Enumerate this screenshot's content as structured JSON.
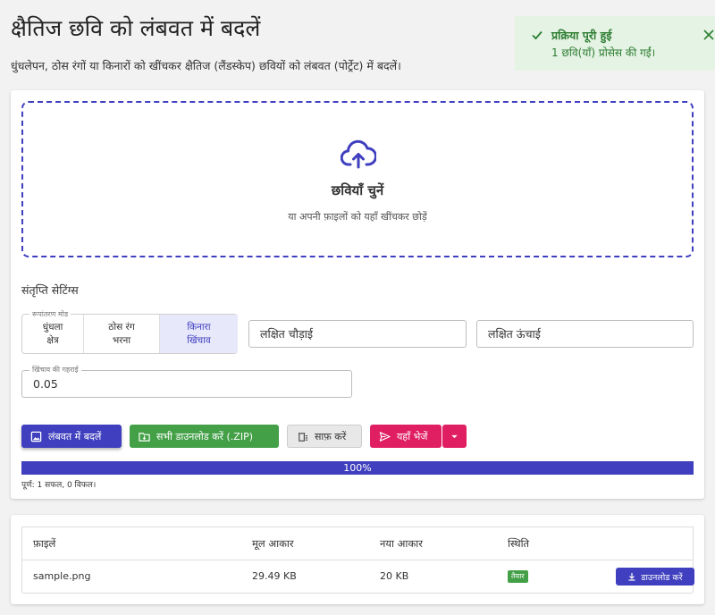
{
  "page": {
    "title": "क्षैतिज छवि को लंबवत में बदलें",
    "subtitle": "धुंधलेपन, ठोस रंगों या किनारों को खींचकर क्षैतिज (लैंडस्केप) छवियों को लंबवत (पोर्ट्रेट) में बदलें।"
  },
  "toast": {
    "title": "प्रक्रिया पूरी हुई",
    "message": "1 छवि(याँ) प्रोसेस की गईं।",
    "icon": "check-icon",
    "close_icon": "close-icon",
    "color": "#2e7d32"
  },
  "dropzone": {
    "title": "छवियाँ चुनें",
    "subtitle": "या अपनी फ़ाइलों को यहाँ खींचकर छोड़ें",
    "icon": "cloud-upload-icon"
  },
  "settings": {
    "section_title": "संतृप्ति सेटिंग्स",
    "mode_legend": "रूपांतरण मोड",
    "modes": [
      {
        "line1": "धुंधला",
        "line2": "क्षेत्र"
      },
      {
        "line1": "ठोस रंग",
        "line2": "भरना"
      },
      {
        "line1": "किनारा",
        "line2": "खिंचाव"
      }
    ],
    "selected_mode": "किनारा खिंचाव",
    "target_width_placeholder": "लक्षित चौड़ाई",
    "target_height_placeholder": "लक्षित ऊंचाई",
    "depth_legend": "खिंचाव की गहराई",
    "depth_value": "0.05"
  },
  "actions": {
    "convert": "लंबवत में बदलें",
    "download_all": "सभी डाउनलोड करें (.ZIP)",
    "clear": "साफ़ करें",
    "send": "यहाँ भेजें",
    "primary_color": "#3f3fbf",
    "download_color": "#43a047",
    "send_color": "#e01f62"
  },
  "progress": {
    "value": 100,
    "label": "100%",
    "status": "पूर्ण: 1 सफल, 0 विफल।"
  },
  "files": {
    "headers": [
      "फ़ाइलें",
      "मूल आकार",
      "नया आकार",
      "स्थिति"
    ],
    "rows": [
      {
        "name": "sample.png",
        "original_size": "29.49 KB",
        "new_size": "20 KB",
        "status": "तैयार",
        "action": "डाउनलोड करें"
      }
    ]
  }
}
